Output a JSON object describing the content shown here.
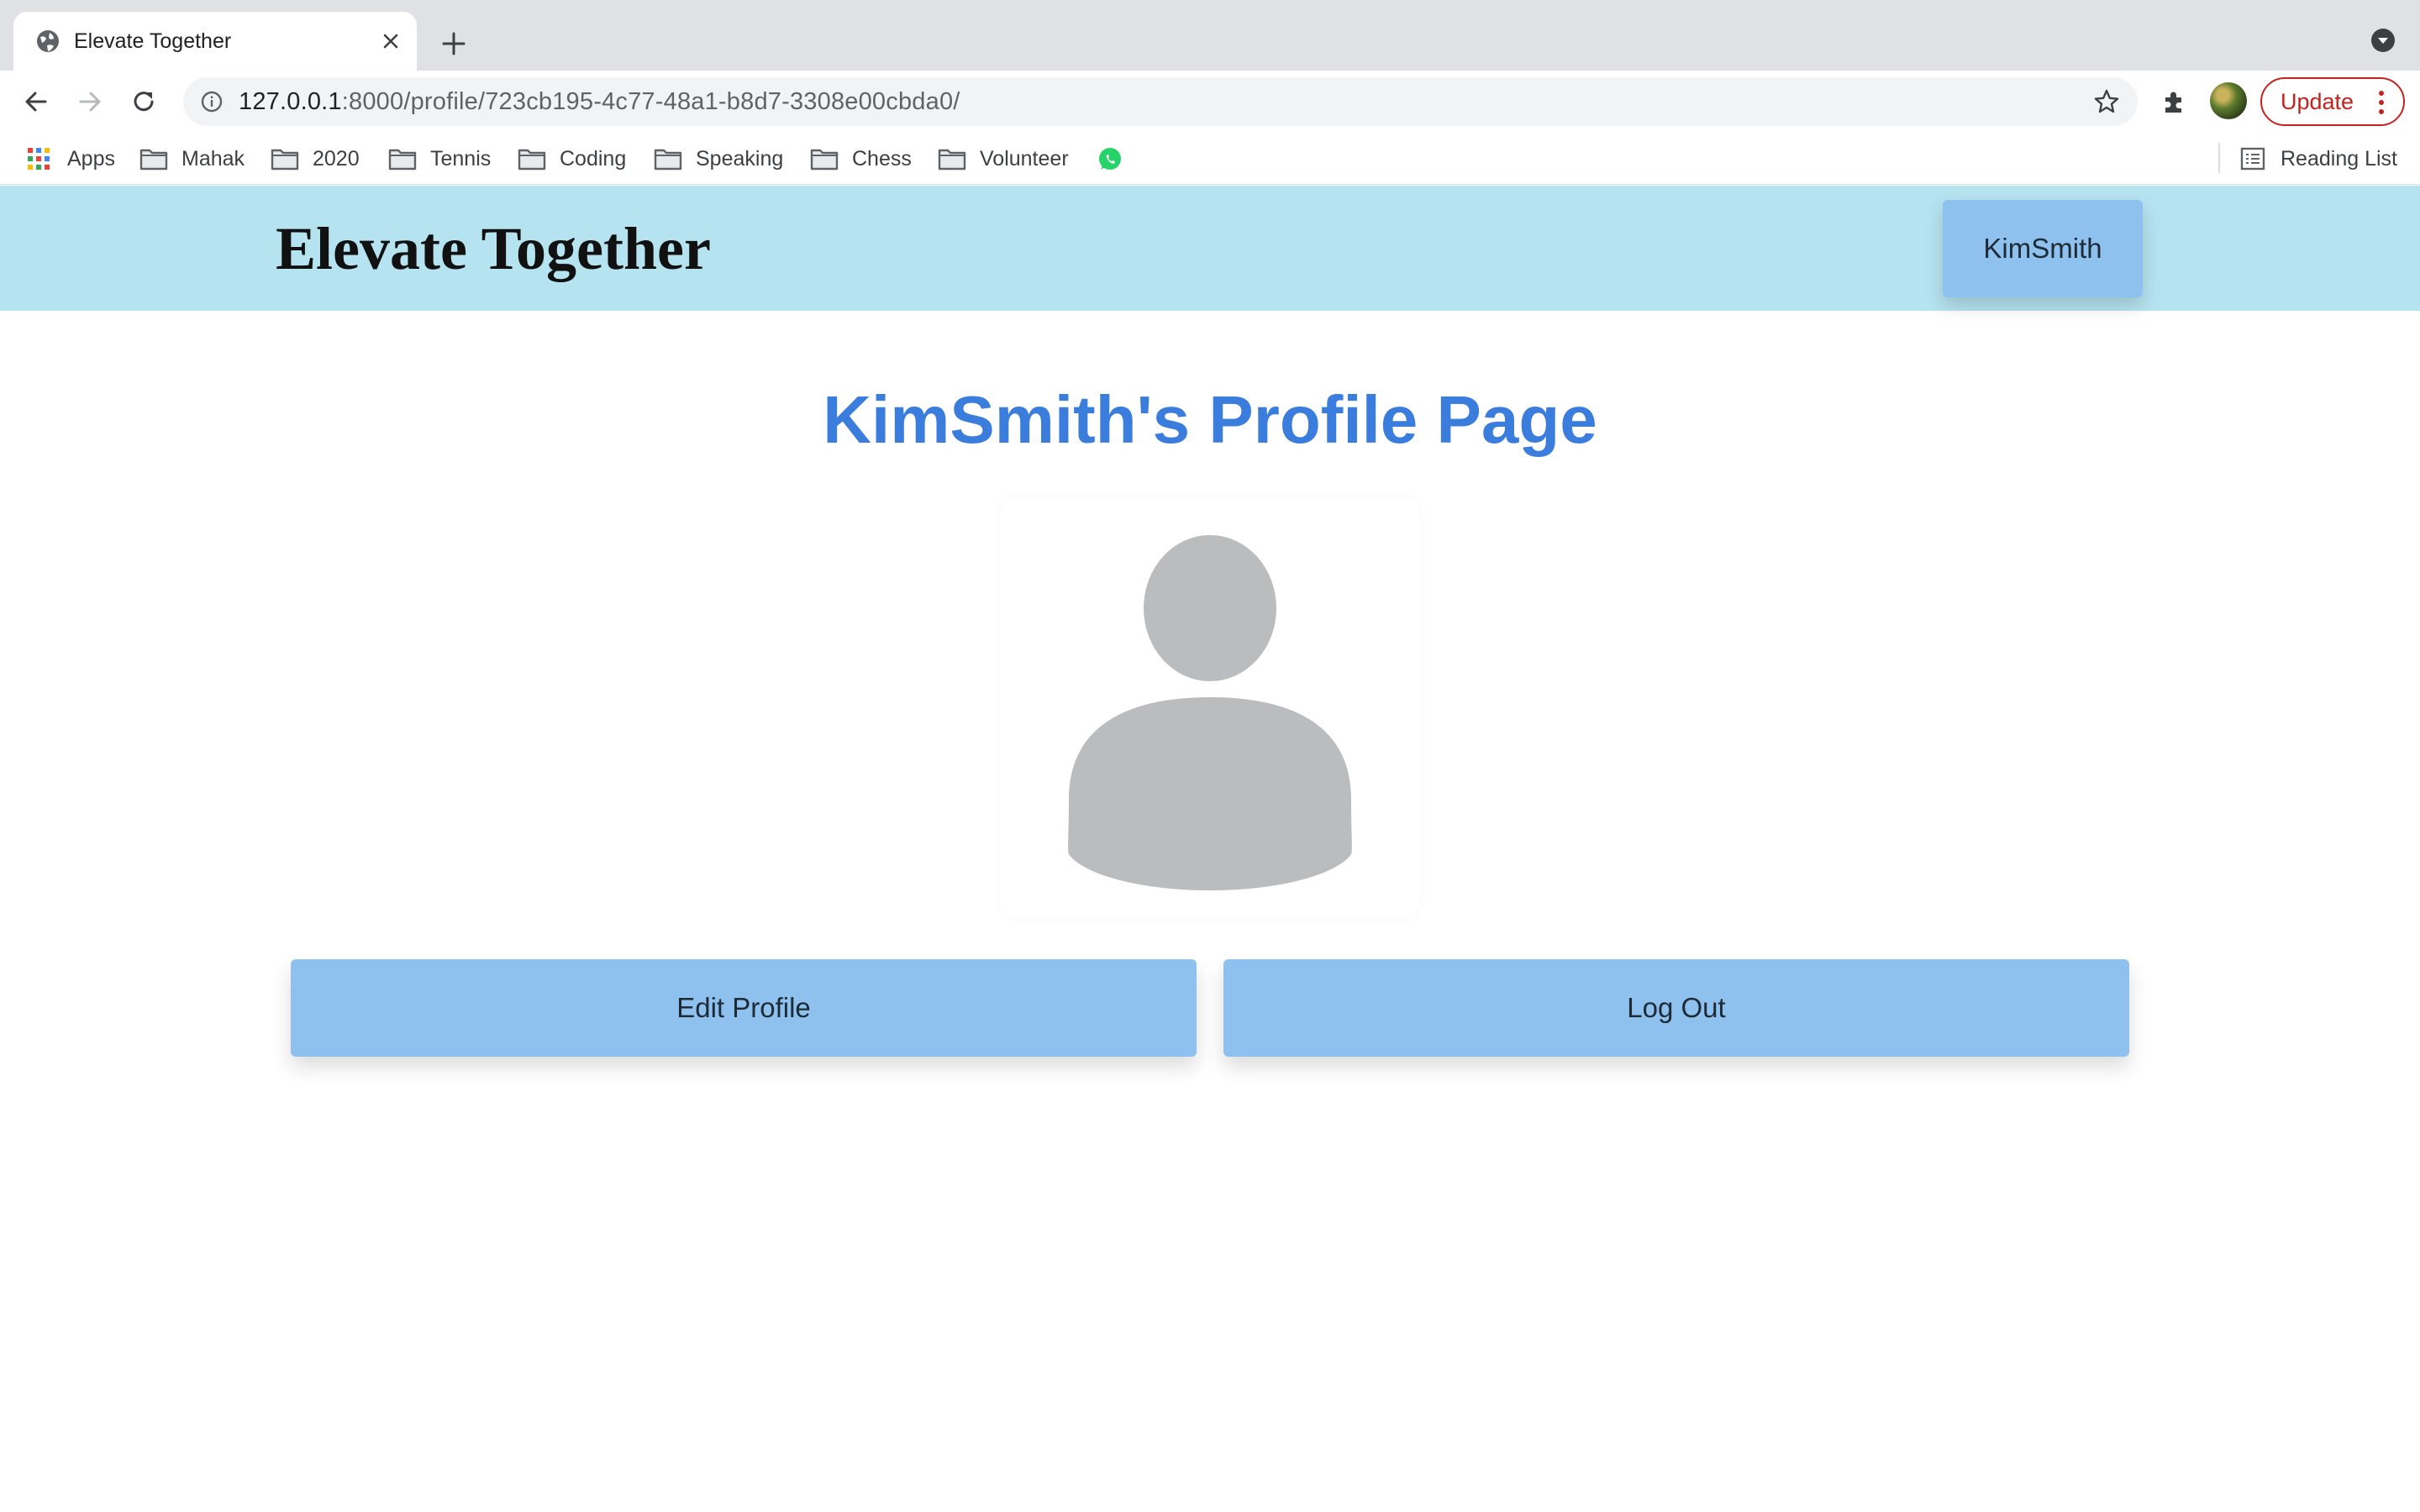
{
  "browser": {
    "tab": {
      "title": "Elevate Together",
      "favicon": "globe-icon"
    },
    "url": {
      "host": "127.0.0.1",
      "path": ":8000/profile/723cb195-4c77-48a1-b8d7-3308e00cbda0/"
    },
    "update_label": "Update",
    "bookmarks": [
      {
        "label": "Apps",
        "icon": "apps-grid-icon"
      },
      {
        "label": "Mahak",
        "icon": "folder-icon"
      },
      {
        "label": "2020",
        "icon": "folder-icon"
      },
      {
        "label": "Tennis",
        "icon": "folder-icon"
      },
      {
        "label": "Coding",
        "icon": "folder-icon"
      },
      {
        "label": "Speaking",
        "icon": "folder-icon"
      },
      {
        "label": "Chess",
        "icon": "folder-icon"
      },
      {
        "label": "Volunteer",
        "icon": "folder-icon"
      },
      {
        "label": "",
        "icon": "whatsapp-icon"
      }
    ],
    "reading_list_label": "Reading List"
  },
  "header": {
    "brand": "Elevate Together",
    "username": "KimSmith"
  },
  "main": {
    "title": "KimSmith's Profile Page",
    "avatar_icon": "user-silhouette-icon",
    "edit_label": "Edit Profile",
    "logout_label": "Log Out"
  },
  "colors": {
    "header_bg": "#b6e3f0",
    "button_bg": "#8fc1ef",
    "title_color": "#3b7ddd",
    "avatar_gray": "#bbbcbe",
    "update_red": "#c5221f"
  }
}
